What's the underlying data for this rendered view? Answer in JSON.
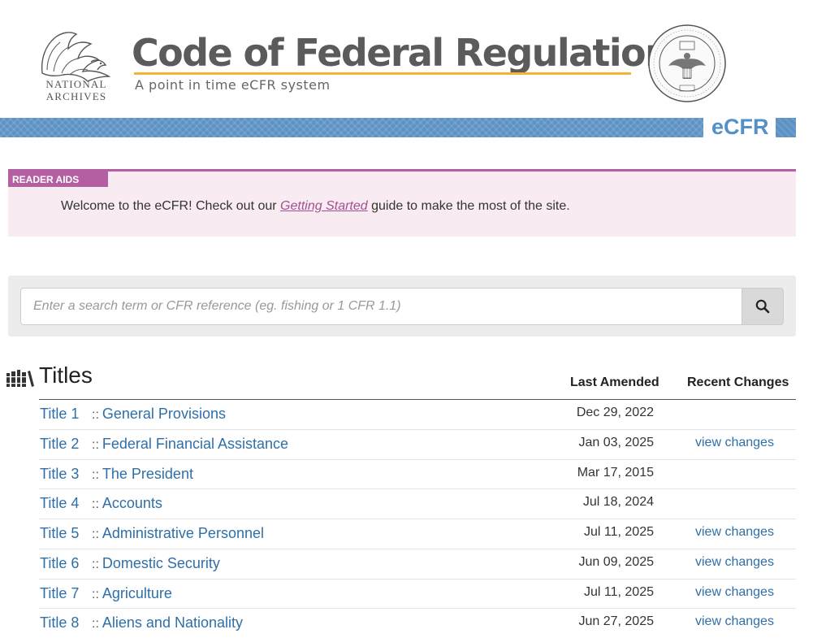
{
  "header": {
    "logo_line1": "NATIONAL",
    "logo_line2": "ARCHIVES",
    "title": "Code of Federal Regulations",
    "subtitle": "A point in time eCFR system",
    "seal_icon": "nara-seal-icon",
    "brand": "eCFR"
  },
  "colors": {
    "accent_blue": "#5d92c5",
    "link_blue": "#2f6fa8",
    "reader_aids": "#b45fa2",
    "title_rule": "#f1b434"
  },
  "reader_aids": {
    "tab_label": "READER AIDS",
    "text_before": "Welcome to the eCFR! Check out our ",
    "link_text": "Getting Started",
    "text_after": " guide to make the most of the site."
  },
  "search": {
    "placeholder": "Enter a search term or CFR reference (eg. fishing or 1 CFR 1.1)",
    "value": "",
    "button_icon": "search-icon"
  },
  "titles": {
    "heading": "Titles",
    "col_last_amended": "Last Amended",
    "col_recent_changes": "Recent Changes",
    "rows": [
      {
        "num": "Title 1",
        "sep": "::",
        "name": "General Provisions",
        "date": "Dec 29, 2022",
        "changes": ""
      },
      {
        "num": "Title 2",
        "sep": "::",
        "name": "Federal Financial Assistance",
        "date": "Jan 03, 2025",
        "changes": "view changes"
      },
      {
        "num": "Title 3",
        "sep": "::",
        "name": "The President",
        "date": "Mar 17, 2015",
        "changes": ""
      },
      {
        "num": "Title 4",
        "sep": "::",
        "name": "Accounts",
        "date": "Jul 18, 2024",
        "changes": ""
      },
      {
        "num": "Title 5",
        "sep": "::",
        "name": "Administrative Personnel",
        "date": "Jul 11, 2025",
        "changes": "view changes"
      },
      {
        "num": "Title 6",
        "sep": "::",
        "name": "Domestic Security",
        "date": "Jun 09, 2025",
        "changes": "view changes"
      },
      {
        "num": "Title 7",
        "sep": "::",
        "name": "Agriculture",
        "date": "Jul 11, 2025",
        "changes": "view changes"
      },
      {
        "num": "Title 8",
        "sep": "::",
        "name": "Aliens and Nationality",
        "date": "Jun 27, 2025",
        "changes": "view changes"
      }
    ]
  }
}
